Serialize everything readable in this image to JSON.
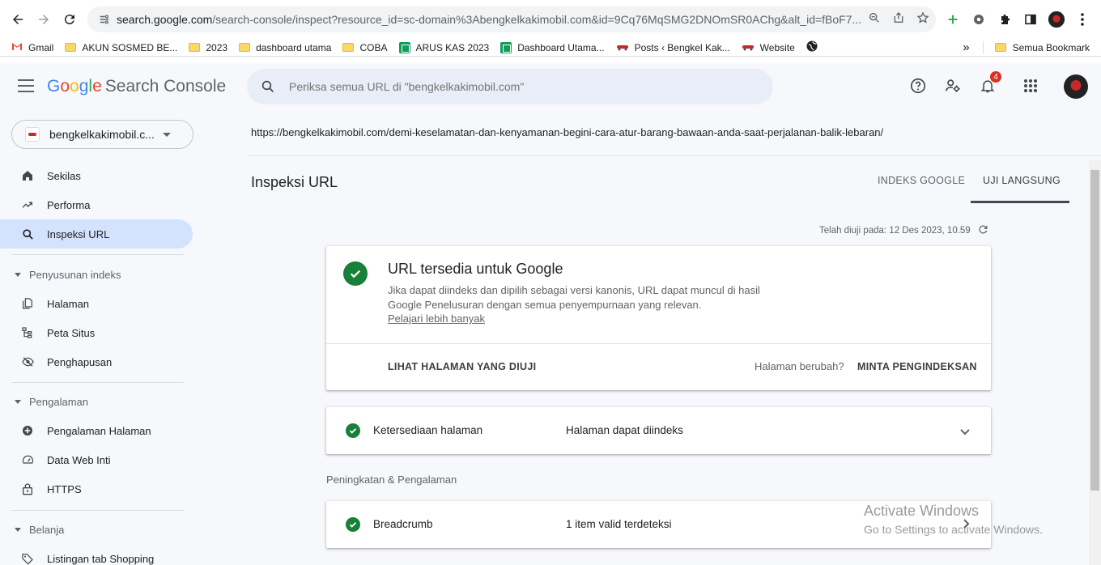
{
  "browser": {
    "url_host": "search.google.com",
    "url_rest": "/search-console/inspect?resource_id=sc-domain%3Abengkelkakimobil.com&id=9Cq76MqSMG2DNOmSR0AChg&alt_id=fBoF7..."
  },
  "bookmarks": {
    "items": [
      {
        "label": "Gmail",
        "icon": "gmail-icon"
      },
      {
        "label": "AKUN SOSMED BE...",
        "icon": "folder-icon"
      },
      {
        "label": "2023",
        "icon": "folder-icon"
      },
      {
        "label": "dashboard utama",
        "icon": "folder-icon"
      },
      {
        "label": "COBA",
        "icon": "folder-icon"
      },
      {
        "label": "ARUS KAS 2023",
        "icon": "sheets-icon"
      },
      {
        "label": "Dashboard Utama...",
        "icon": "sheets-icon"
      },
      {
        "label": "Posts ‹ Bengkel Kak...",
        "icon": "site-icon"
      },
      {
        "label": "Website",
        "icon": "site-icon"
      }
    ],
    "overflow": "»",
    "all_bookmarks": "Semua Bookmark"
  },
  "app": {
    "logo_google": [
      "G",
      "o",
      "o",
      "g",
      "l",
      "e"
    ],
    "logo_product": "Search Console",
    "search_placeholder": "Periksa semua URL di \"bengkelkakimobil.com\"",
    "notification_count": "4",
    "colors": {
      "accent": "#1a73e8",
      "success": "#188038",
      "active_nav": "#d3e3fd",
      "app_bg": "#f7f8fc"
    }
  },
  "sidebar": {
    "property": "bengkelkakimobil.c...",
    "items": [
      {
        "label": "Sekilas",
        "icon": "home-icon"
      },
      {
        "label": "Performa",
        "icon": "trending-up-icon"
      },
      {
        "label": "Inspeksi URL",
        "icon": "search-icon",
        "active": true
      }
    ],
    "sections": [
      {
        "title": "Penyusunan indeks",
        "items": [
          {
            "label": "Halaman",
            "icon": "pages-icon"
          },
          {
            "label": "Peta Situs",
            "icon": "sitemap-icon"
          },
          {
            "label": "Penghapusan",
            "icon": "eye-off-icon"
          }
        ]
      },
      {
        "title": "Pengalaman",
        "items": [
          {
            "label": "Pengalaman Halaman",
            "icon": "plus-circle-icon"
          },
          {
            "label": "Data Web Inti",
            "icon": "speed-icon"
          },
          {
            "label": "HTTPS",
            "icon": "lock-icon"
          }
        ]
      },
      {
        "title": "Belanja",
        "items": [
          {
            "label": "Listingan tab Shopping",
            "icon": "tag-icon"
          }
        ]
      }
    ]
  },
  "main": {
    "inspected_url": "https://bengkelkakimobil.com/demi-keselamatan-dan-kenyamanan-begini-cara-atur-barang-bawaan-anda-saat-perjalanan-balik-lebaran/",
    "page_title": "Inspeksi URL",
    "tabs": [
      {
        "label": "INDEKS GOOGLE"
      },
      {
        "label": "UJI LANGSUNG",
        "active": true
      }
    ],
    "tested_at": "Telah diuji pada: 12 Des 2023, 10.59",
    "status_card": {
      "title": "URL tersedia untuk Google",
      "description": "Jika dapat diindeks dan dipilih sebagai versi kanonis, URL dapat muncul di hasil Google Penelusuran dengan semua penyempurnaan yang relevan.",
      "learn_more": "Pelajari lebih banyak",
      "view_tested_button": "LIHAT HALAMAN YANG DIUJI",
      "changed_question": "Halaman berubah?",
      "request_indexing_button": "MINTA PENGINDEKSAN"
    },
    "availability_row": {
      "label": "Ketersediaan halaman",
      "value": "Halaman dapat diindeks"
    },
    "enhancements_label": "Peningkatan & Pengalaman",
    "breadcrumb_row": {
      "label": "Breadcrumb",
      "value": "1 item valid terdeteksi"
    }
  },
  "watermark": {
    "line1": "Activate Windows",
    "line2": "Go to Settings to activate Windows."
  }
}
